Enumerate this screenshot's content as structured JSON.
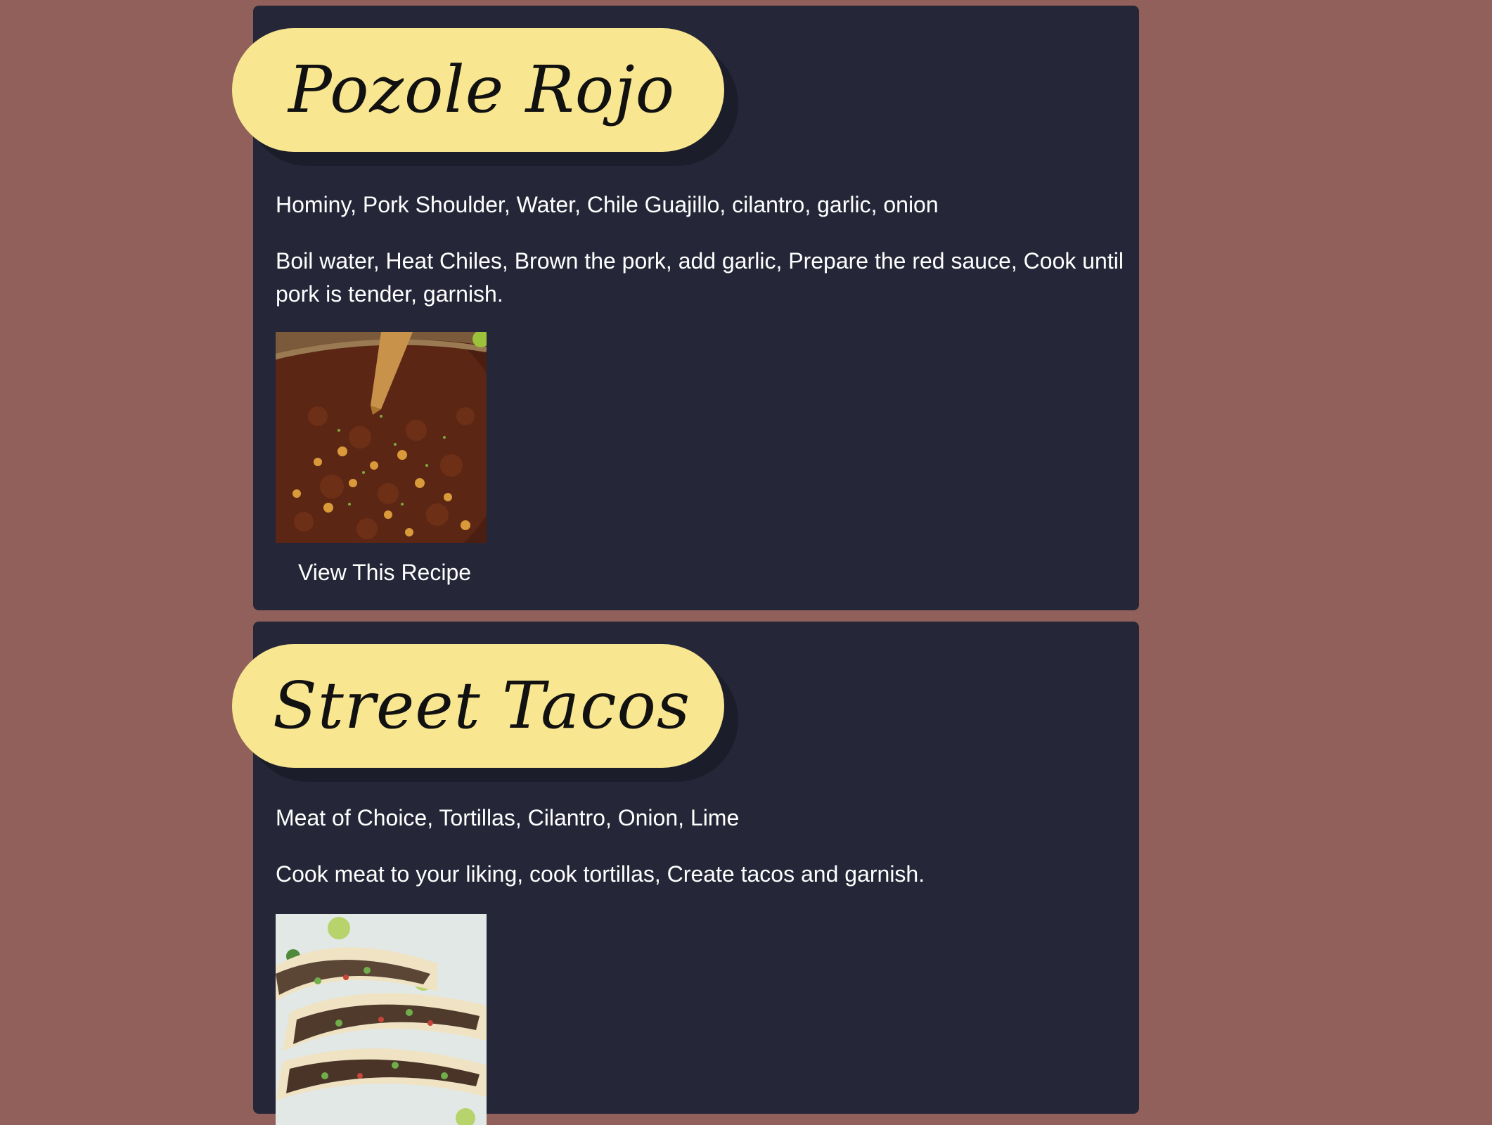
{
  "recipes": [
    {
      "title": "Pozole Rojo",
      "ingredients": "Hominy, Pork Shoulder, Water, Chile Guajillo, cilantro, garlic, onion",
      "steps": "Boil water, Heat Chiles, Brown the pork, add garlic, Prepare the red sauce, Cook until pork is tender, garnish.",
      "link_label": "View This Recipe"
    },
    {
      "title": "Street Tacos",
      "ingredients": "Meat of Choice, Tortillas, Cilantro, Onion, Lime",
      "steps": "Cook meat to your liking, cook tortillas, Create tacos and garnish."
    }
  ],
  "colors": {
    "page_background": "#92605a",
    "card_background": "#252738",
    "title_pill": "#f8e691",
    "text": "#ffffff"
  }
}
